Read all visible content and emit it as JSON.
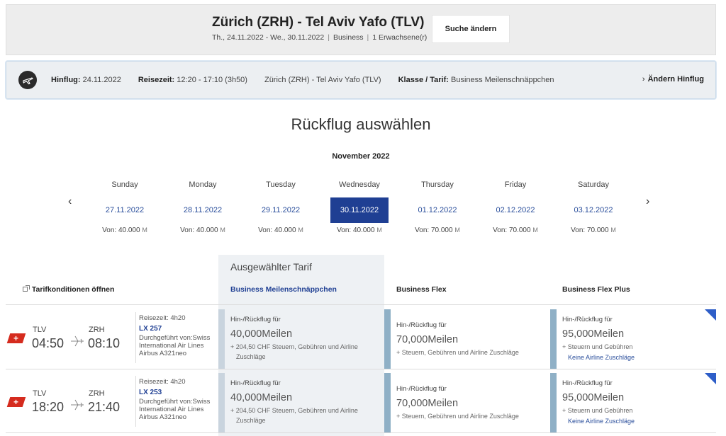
{
  "search_summary": {
    "route": "Zürich (ZRH) - Tel Aviv Yafo (TLV)",
    "dates": "Th., 24.11.2022 - We., 30.11.2022",
    "cabin": "Business",
    "passengers": "1 Erwachsene(r)",
    "change_search_label": "Suche ändern"
  },
  "outbound": {
    "flight_label": "Hinflug:",
    "flight_date": "24.11.2022",
    "time_label": "Reisezeit:",
    "time_value": "12:20 - 17:10 (3h50)",
    "route": "Zürich (ZRH) - Tel Aviv Yafo (TLV)",
    "class_label": "Klasse / Tarif:",
    "class_value": "Business Meilenschnäppchen",
    "change_label": "Ändern Hinflug"
  },
  "page_title": "Rückflug auswählen",
  "calendar": {
    "month": "November 2022",
    "days": [
      {
        "name": "Sunday",
        "date": "27.11.2022",
        "price": "Von: 40.000",
        "unit": "M",
        "selected": false
      },
      {
        "name": "Monday",
        "date": "28.11.2022",
        "price": "Von: 40.000",
        "unit": "M",
        "selected": false
      },
      {
        "name": "Tuesday",
        "date": "29.11.2022",
        "price": "Von: 40.000",
        "unit": "M",
        "selected": false
      },
      {
        "name": "Wednesday",
        "date": "30.11.2022",
        "price": "Von: 40.000",
        "unit": "M",
        "selected": true
      },
      {
        "name": "Thursday",
        "date": "01.12.2022",
        "price": "Von: 70.000",
        "unit": "M",
        "selected": false
      },
      {
        "name": "Friday",
        "date": "02.12.2022",
        "price": "Von: 70.000",
        "unit": "M",
        "selected": false
      },
      {
        "name": "Saturday",
        "date": "03.12.2022",
        "price": "Von: 70.000",
        "unit": "M",
        "selected": false
      }
    ]
  },
  "fares": {
    "tariff_conditions_label": "Tarifkonditionen öffnen",
    "selected_fare_title": "Ausgewählter Tarif",
    "columns": [
      "Business Meilenschnäppchen",
      "Business Flex",
      "Business Flex Plus"
    ]
  },
  "flights": [
    {
      "dep_code": "TLV",
      "dep_time": "04:50",
      "arr_code": "ZRH",
      "arr_time": "08:10",
      "duration_label": "Reisezeit:",
      "duration": "4h20",
      "flight_no": "LX 257",
      "operator": "Durchgeführt von:Swiss",
      "operator2": "International Air Lines",
      "aircraft": "Airbus A321neo",
      "fare1": {
        "label": "Hin-/Rückflug für",
        "miles": "40,000Meilen",
        "tax": "+ 204,50 CHF Steuern, Gebühren und Airline",
        "tax2": "Zuschläge"
      },
      "fare2": {
        "label": "Hin-/Rückflug für",
        "miles": "70,000Meilen",
        "tax": "+ Steuern, Gebühren und Airline Zuschläge"
      },
      "fare3": {
        "label": "Hin-/Rückflug für",
        "miles": "95,000Meilen",
        "tax": "+ Steuern und Gebühren",
        "note": "Keine Airline Zuschläge"
      }
    },
    {
      "dep_code": "TLV",
      "dep_time": "18:20",
      "arr_code": "ZRH",
      "arr_time": "21:40",
      "duration_label": "Reisezeit:",
      "duration": "4h20",
      "flight_no": "LX 253",
      "operator": "Durchgeführt von:Swiss",
      "operator2": "International Air Lines",
      "aircraft": "Airbus A321neo",
      "fare1": {
        "label": "Hin-/Rückflug für",
        "miles": "40,000Meilen",
        "tax": "+ 204,50 CHF Steuern, Gebühren und Airline",
        "tax2": "Zuschläge"
      },
      "fare2": {
        "label": "Hin-/Rückflug für",
        "miles": "70,000Meilen",
        "tax": "+ Steuern, Gebühren und Airline Zuschläge"
      },
      "fare3": {
        "label": "Hin-/Rückflug für",
        "miles": "95,000Meilen",
        "tax": "+ Steuern und Gebühren",
        "note": "Keine Airline Zuschläge"
      }
    }
  ],
  "colors": {
    "accent": "#1f3f93",
    "link": "#2b4f9c",
    "swiss_red": "#d52b1e",
    "fare_bar": "#8fb0c6"
  }
}
